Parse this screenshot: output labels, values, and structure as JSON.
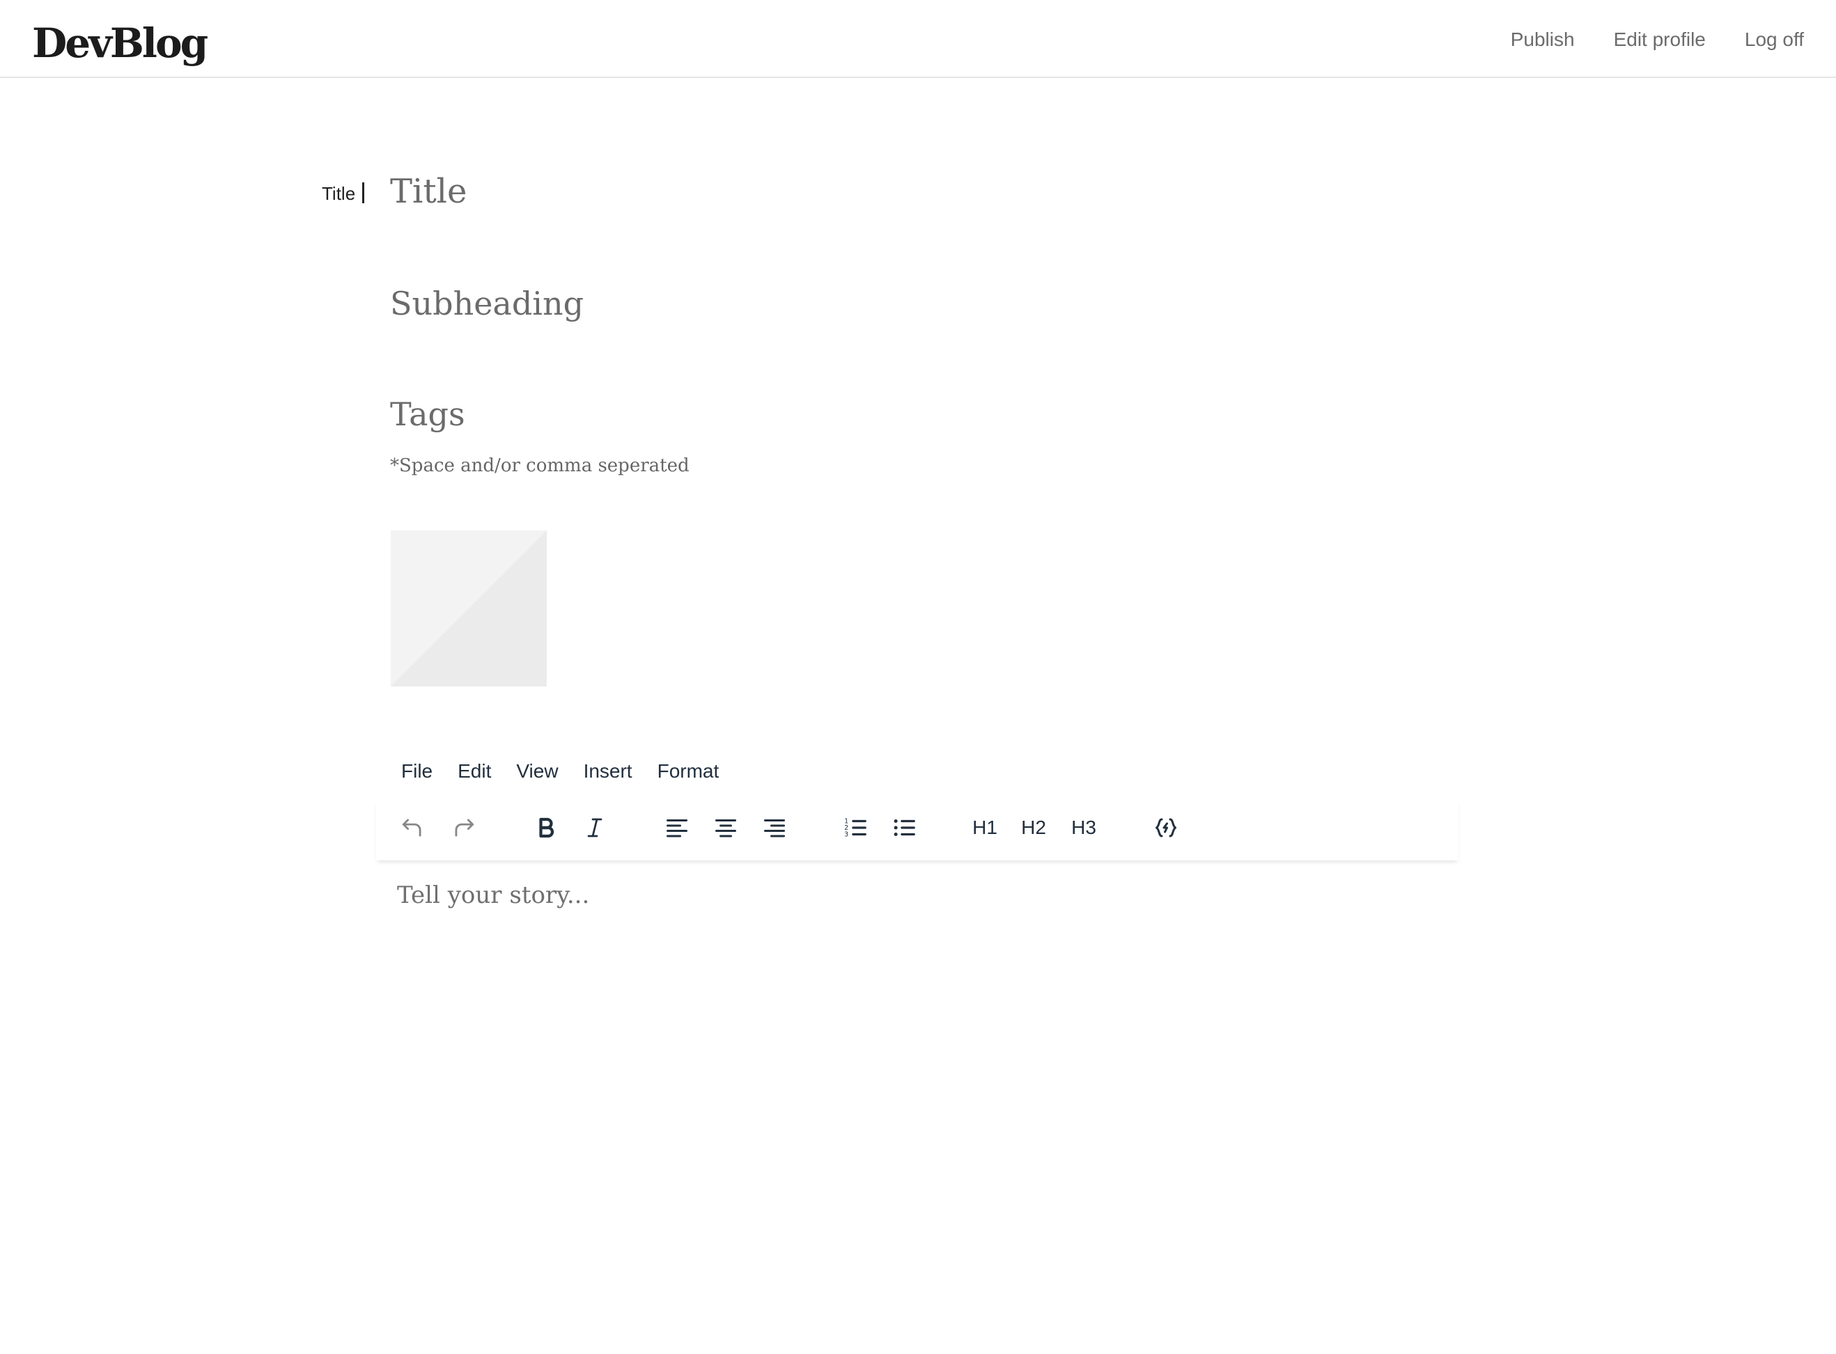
{
  "header": {
    "logo": "DevBlog",
    "nav": {
      "publish": "Publish",
      "edit_profile": "Edit profile",
      "log_off": "Log off"
    }
  },
  "form": {
    "title_label": "Title",
    "title_placeholder": "Title",
    "subheading_placeholder": "Subheading",
    "tags_placeholder": "Tags",
    "tags_hint": "*Space and/or comma seperated"
  },
  "editor": {
    "menu": {
      "file": "File",
      "edit": "Edit",
      "view": "View",
      "insert": "Insert",
      "format": "Format"
    },
    "toolbar": {
      "icons": [
        "undo-icon",
        "redo-icon",
        "bold-icon",
        "italic-icon",
        "align-left-icon",
        "align-center-icon",
        "align-right-icon",
        "numbered-list-icon",
        "bullet-list-icon",
        "code-sample-icon"
      ],
      "h1": "H1",
      "h2": "H2",
      "h3": "H3"
    },
    "body_placeholder": "Tell your story..."
  },
  "colors": {
    "toolbar_icon": "#222f3e",
    "muted_text": "#6b6b6b",
    "placeholder_bg": "#f3f3f3"
  }
}
